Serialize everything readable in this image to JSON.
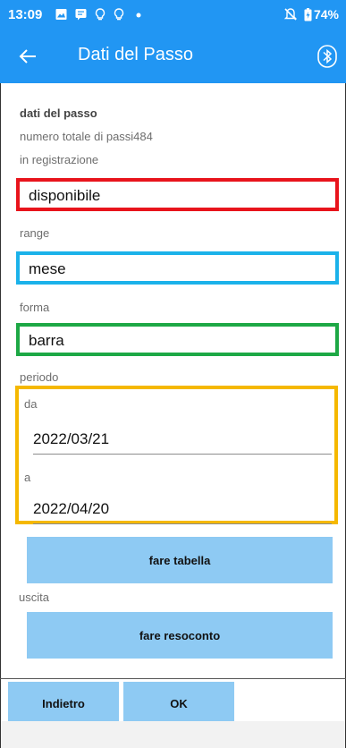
{
  "status_bar": {
    "time": "13:09",
    "battery": "74%",
    "left_icons": [
      "image-icon",
      "chat-icon",
      "lightbulb-icon",
      "lightbulb-icon",
      "dot-icon"
    ],
    "right_icons": [
      "mute-icon",
      "battery-icon"
    ]
  },
  "app_bar": {
    "title": "Dati del Passo",
    "back_icon": "arrow-left-icon",
    "action_icon": "bluetooth-icon"
  },
  "content": {
    "section_title": "dati del passo",
    "total_steps_label": "numero totale di passi484",
    "recording_label": "in registrazione",
    "recording_value": "disponibile",
    "range_label": "range",
    "range_value": "mese",
    "shape_label": "forma",
    "shape_value": "barra",
    "period_label": "periodo",
    "from_label": "da",
    "from_value": "2022/03/21",
    "to_label": "a",
    "to_value": "2022/04/20",
    "make_table_button": "fare tabella",
    "output_label": "uscita",
    "make_report_button": "fare resoconto"
  },
  "footer": {
    "back_button": "Indietro",
    "ok_button": "OK"
  },
  "colors": {
    "primary": "#2196f3",
    "button": "#8ecaf3",
    "highlight_recording": "#e8141c",
    "highlight_range": "#1bb2ea",
    "highlight_shape": "#1da845",
    "highlight_period": "#f5b800"
  }
}
